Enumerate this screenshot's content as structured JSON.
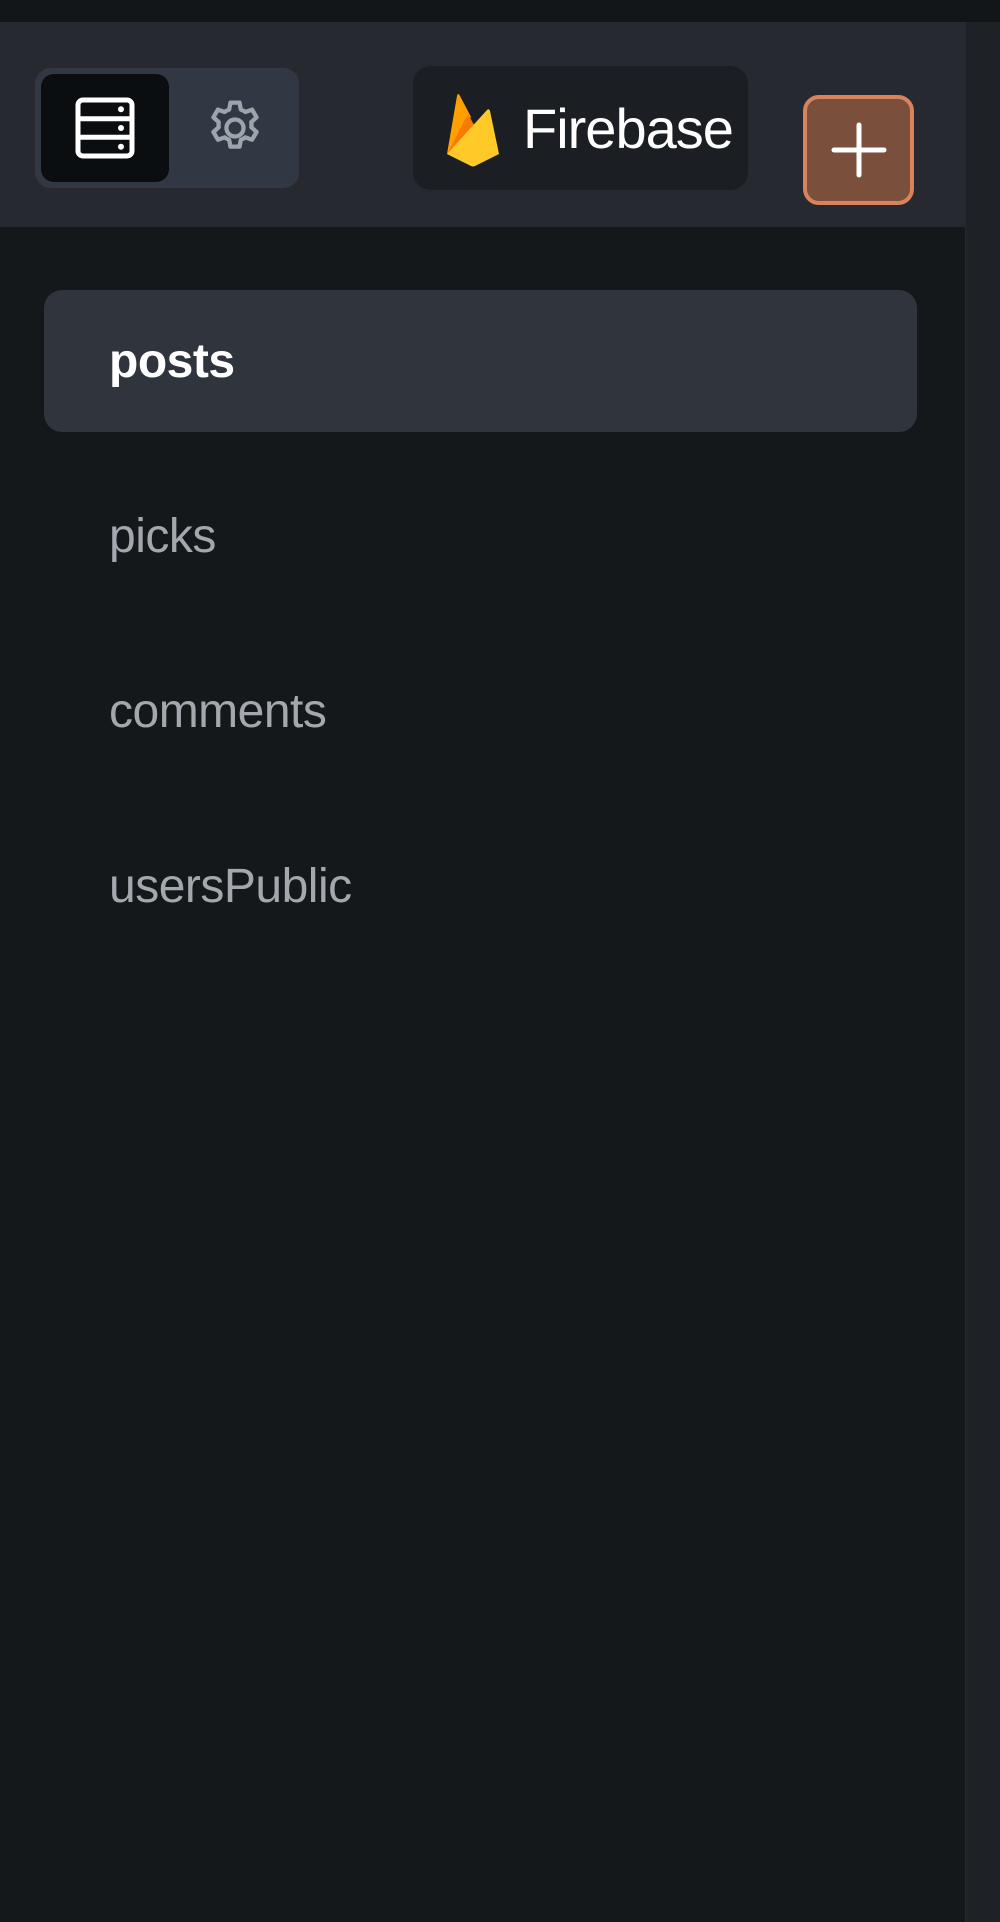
{
  "header": {
    "brand_name": "Firebase",
    "brand_logo": "firebase-flame-logo",
    "view_toggle": [
      {
        "icon": "database-icon",
        "selected": true
      },
      {
        "icon": "gear-icon",
        "selected": false
      }
    ],
    "add_icon": "plus-icon"
  },
  "collections": {
    "items": [
      {
        "label": "posts",
        "active": true
      },
      {
        "label": "picks",
        "active": false
      },
      {
        "label": "comments",
        "active": false
      },
      {
        "label": "usersPublic",
        "active": false
      }
    ]
  },
  "colors": {
    "accent": "#d8835b",
    "accent_fill": "#7a4f3c",
    "background": "#15181b",
    "header_background": "#262a30",
    "active_item_background": "#2f343d"
  }
}
